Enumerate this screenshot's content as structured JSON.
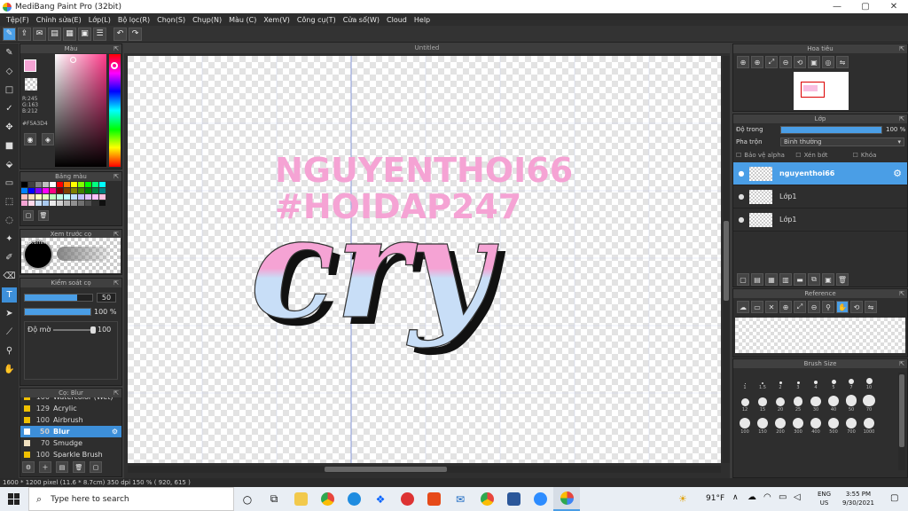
{
  "window": {
    "title": "MediBang Paint Pro (32bit)",
    "controls": [
      "—",
      "▢",
      "✕"
    ]
  },
  "menu": [
    "Tệp(F)",
    "Chỉnh sửa(E)",
    "Lớp(L)",
    "Bộ lọc(R)",
    "Chọn(S)",
    "Chụp(N)",
    "Màu (C)",
    "Xem(V)",
    "Công cụ(T)",
    "Cửa số(W)",
    "Cloud",
    "Help"
  ],
  "panels": {
    "color": {
      "title": "Màu",
      "r": "R:245",
      "g": "G:163",
      "b": "B:212",
      "hex": "#F5A3D4",
      "fg_color": "#f5a3d4"
    },
    "palette": {
      "title": "Bảng màu",
      "colors": [
        "#000000",
        "#404040",
        "#808080",
        "#c0c0c0",
        "#ffffff",
        "#ff0000",
        "#ff8000",
        "#ffff00",
        "#80ff00",
        "#00ff00",
        "#00ff80",
        "#00ffff",
        "#0080ff",
        "#0000ff",
        "#8000ff",
        "#ff00ff",
        "#ff0080",
        "#800000",
        "#804000",
        "#808000",
        "#408000",
        "#008000",
        "#008040",
        "#008080",
        "#ffc0c0",
        "#ffe0c0",
        "#ffffc0",
        "#e0ffc0",
        "#c0ffc0",
        "#c0ffe0",
        "#c0ffff",
        "#c0e0ff",
        "#c0c0ff",
        "#e0c0ff",
        "#ffc0ff",
        "#ffc0e0",
        "#f5a3d4",
        "#ffd8ea",
        "#c8def7",
        "#a9c9ef",
        "#eaeaea",
        "#d0d0d0",
        "#b0b0b0",
        "#909090",
        "#707070",
        "#505050",
        "#303030",
        "#101010"
      ]
    },
    "preview": {
      "title": "Xem trước cọ",
      "size": "23.6mm"
    },
    "control": {
      "title": "Kiểm soát cọ",
      "size_value": "50",
      "size_fill": 0.77,
      "opacity_label": "100 %",
      "opacity_fill": 1.0,
      "blur_label": "Độ mờ",
      "blur_value": "100"
    },
    "brushes": {
      "title": "Cọ: Blur",
      "items": [
        {
          "num": "100",
          "name": "Watercolor (Wet)",
          "color": "#f0c000",
          "selected": false
        },
        {
          "num": "129",
          "name": "Acrylic",
          "color": "#f0c000",
          "selected": false
        },
        {
          "num": "100",
          "name": "Airbrush",
          "color": "#f0c000",
          "selected": false
        },
        {
          "num": "50",
          "name": "Blur",
          "color": "#ffffff",
          "selected": true
        },
        {
          "num": "70",
          "name": "Smudge",
          "color": "#f0e0c0",
          "selected": false
        },
        {
          "num": "100",
          "name": "Sparkle Brush",
          "color": "#f0c000",
          "selected": false
        }
      ]
    },
    "navigator": {
      "title": "Hoa tiêu"
    },
    "layers": {
      "title": "Lớp",
      "opacity_label": "Độ trong",
      "opacity_value": "100 %",
      "blend_label": "Pha trộn",
      "blend_value": "Bình thường",
      "check_alpha": "Bảo vệ alpha",
      "check_clip": "Xén bớt",
      "check_lock": "Khóa",
      "items": [
        {
          "name": "nguyenthoi66",
          "selected": true
        },
        {
          "name": "Lớp1",
          "selected": false
        },
        {
          "name": "Lớp1",
          "selected": false
        }
      ]
    },
    "reference": {
      "title": "Reference"
    },
    "brush_size": {
      "title": "Brush Size",
      "sizes": [
        "1",
        "1.5",
        "2",
        "3",
        "4",
        "5",
        "7",
        "10",
        "12",
        "15",
        "20",
        "25",
        "30",
        "40",
        "50",
        "70",
        "100",
        "150",
        "200",
        "300",
        "400",
        "500",
        "700",
        "1000"
      ]
    }
  },
  "document": {
    "tab_title": "Untitled",
    "text_line1": "NGUYENTHOI66",
    "text_line2": "#HOIDAP247",
    "script_text": "cry",
    "pink": "#f5a3d4",
    "light_blue": "#c8def7"
  },
  "status": {
    "text": "1600 * 1200 pixel   (11.6 * 8.7cm)   350 dpi   150 %   ( 920, 615 )"
  },
  "taskbar": {
    "search_placeholder": "Type here to search",
    "weather": "91°F",
    "lang": "ENG",
    "region": "US",
    "time": "3:55 PM",
    "date": "9/30/2021"
  }
}
